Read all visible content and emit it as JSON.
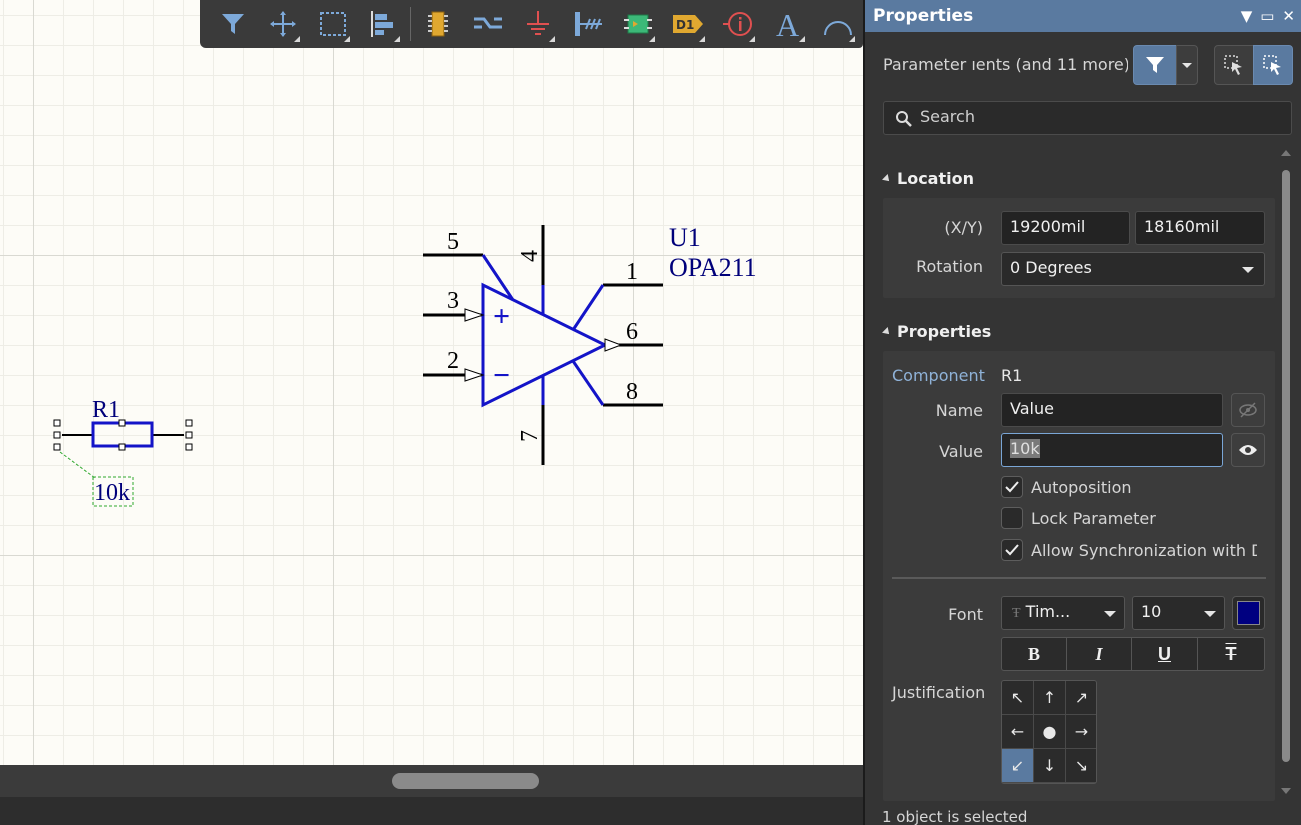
{
  "toolbar": {
    "tools": [
      {
        "icon": "filter-icon",
        "color": "#7da9d9"
      },
      {
        "icon": "move-crosshair-icon",
        "color": "#7da9d9"
      },
      {
        "icon": "select-rectangle-icon",
        "color": "#7da9d9"
      },
      {
        "icon": "align-left-icon",
        "color": "#7da9d9"
      },
      {
        "icon": "place-part-icon",
        "color": "#e0a830"
      },
      {
        "icon": "wire-icon",
        "color": "#7da9d9"
      },
      {
        "icon": "power-ground-icon",
        "color": "#e05050"
      },
      {
        "icon": "bus-harness-icon",
        "color": "#7da9d9"
      },
      {
        "icon": "sheet-symbol-icon",
        "color": "#3cb878"
      },
      {
        "icon": "designator-icon",
        "color": "#e0a830",
        "text": "D1"
      },
      {
        "icon": "directive-icon",
        "color": "#e05050",
        "text": "i"
      },
      {
        "icon": "text-icon",
        "color": "#7da9d9",
        "text": "A"
      },
      {
        "icon": "arc-icon",
        "color": "#7da9d9"
      }
    ]
  },
  "schematic": {
    "resistor": {
      "designator": "R1",
      "value": "10k"
    },
    "opamp": {
      "designator": "U1",
      "part": "OPA211",
      "pins": [
        "5",
        "4",
        "3",
        "2",
        "1",
        "6",
        "8",
        "7"
      ],
      "plus": "+",
      "minus": "−"
    },
    "colors": {
      "part": "#1414c8",
      "text": "#00007a",
      "wire": "#000000",
      "selection": "#2ea82e"
    }
  },
  "panel": {
    "title": "Properties",
    "filter_text": "Parameter   ıents (and 11 more)",
    "search_placeholder": "Search",
    "location": {
      "header": "Location",
      "xy_label": "(X/Y)",
      "x": "19200mil",
      "y": "18160mil",
      "rotation_label": "Rotation",
      "rotation": "0 Degrees"
    },
    "properties": {
      "header": "Properties",
      "component_label": "Component",
      "component": "R1",
      "name_label": "Name",
      "name": "Value",
      "value_label": "Value",
      "value": "10k",
      "autoposition": {
        "label": "Autoposition",
        "checked": true
      },
      "lock_parameter": {
        "label": "Lock Parameter",
        "checked": false
      },
      "allow_sync": {
        "label": "Allow Synchronization with Da",
        "checked": true
      },
      "font_label": "Font",
      "font": "Tim...",
      "font_size": "10",
      "font_color": "#000080",
      "style_buttons": [
        "B",
        "I",
        "U",
        "T"
      ],
      "justification_label": "Justification",
      "justification": [
        "↖",
        "↑",
        "↗",
        "←",
        "●",
        "→",
        "↙",
        "↓",
        "↘"
      ],
      "justification_selected": "↙"
    },
    "status": "1 object is selected",
    "accent": "#5a7aa0"
  }
}
